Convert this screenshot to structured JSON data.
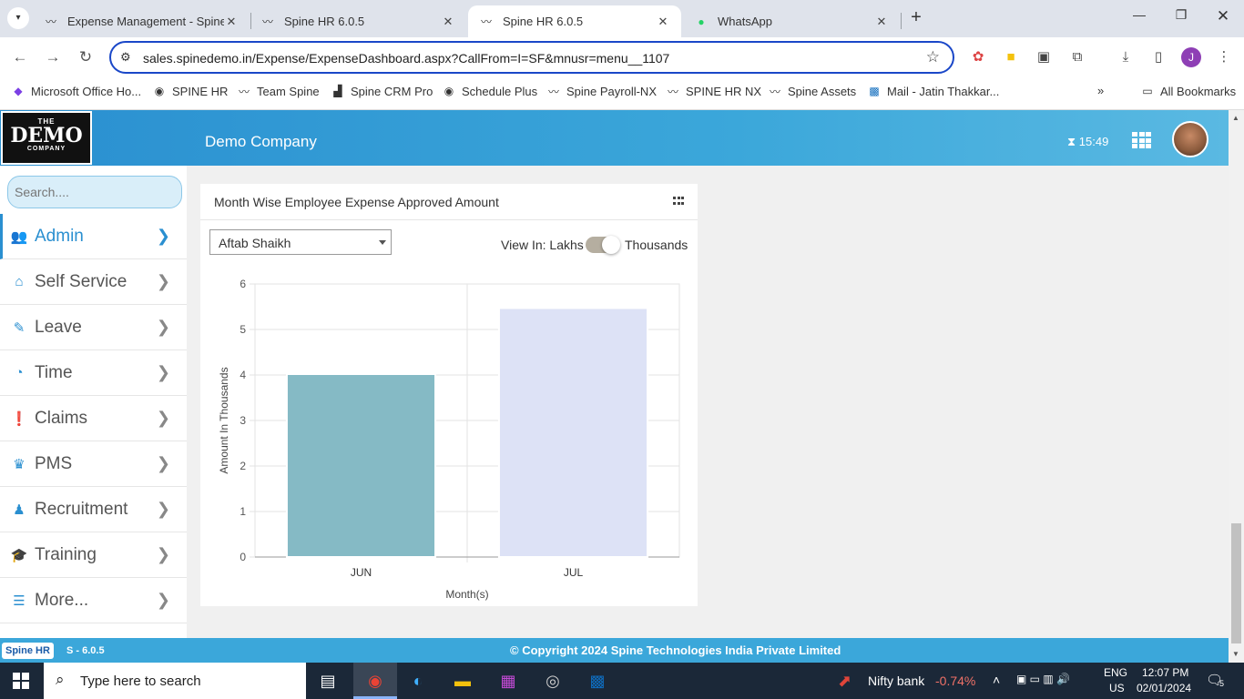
{
  "browser": {
    "tabs": [
      {
        "title": "Expense Management - Spine T",
        "icon": "spine-icon",
        "active": false
      },
      {
        "title": "Spine HR 6.0.5",
        "icon": "spine-icon",
        "active": false
      },
      {
        "title": "Spine HR 6.0.5",
        "icon": "spine-icon",
        "active": true
      },
      {
        "title": "WhatsApp",
        "icon": "whatsapp-icon",
        "active": false
      }
    ],
    "url": "sales.spinedemo.in/Expense/ExpenseDashboard.aspx?CallFrom=I=SF&mnusr=menu__1107",
    "profile_initial": "J",
    "bookmarks": [
      "Microsoft Office Ho...",
      "SPINE HR",
      "Team Spine",
      "Spine CRM Pro",
      "Schedule Plus",
      "Spine Payroll-NX",
      "SPINE HR NX",
      "Spine Assets",
      "Mail - Jatin Thakkar..."
    ],
    "all_bookmarks": "All Bookmarks"
  },
  "header": {
    "logo": {
      "the": "THE",
      "demo": "DEMO",
      "company": "COMPANY"
    },
    "company_name": "Demo Company",
    "time": "15:49"
  },
  "sidebar": {
    "search_placeholder": "Search....",
    "items": [
      {
        "label": "Admin",
        "icon": "admin-icon",
        "active": true
      },
      {
        "label": "Self Service",
        "icon": "home-icon",
        "active": false
      },
      {
        "label": "Leave",
        "icon": "edit-icon",
        "active": false
      },
      {
        "label": "Time",
        "icon": "user-clock-icon",
        "active": false
      },
      {
        "label": "Claims",
        "icon": "alert-icon",
        "active": false
      },
      {
        "label": "PMS",
        "icon": "trophy-icon",
        "active": false
      },
      {
        "label": "Recruitment",
        "icon": "user-tie-icon",
        "active": false
      },
      {
        "label": "Training",
        "icon": "graduation-cap-icon",
        "active": false
      },
      {
        "label": "More...",
        "icon": "list-icon",
        "active": false
      }
    ]
  },
  "panel": {
    "title": "Month Wise Employee Expense Approved Amount",
    "employee_select": "Aftab Shaikh",
    "view_in_label": "View In: Lakhs",
    "view_in_alt": "Thousands"
  },
  "chart_data": {
    "type": "bar",
    "categories": [
      "JUN",
      "JUL"
    ],
    "values": [
      4.02,
      5.47
    ],
    "colors": [
      "#85bac5",
      "#dde2f6"
    ],
    "xlabel": "Month(s)",
    "ylabel": "Amount In Thousands",
    "ylim": [
      0,
      6
    ],
    "yticks": [
      0,
      1,
      2,
      3,
      4,
      5,
      6
    ],
    "grid": true
  },
  "footer": {
    "logo": "Spine HR",
    "version": "S - 6.0.5",
    "copyright": "© Copyright 2024 Spine Technologies India Private Limited"
  },
  "taskbar": {
    "search_placeholder": "Type here to search",
    "stock_name": "Nifty bank",
    "stock_change": "-0.74%",
    "lang_line1": "ENG",
    "lang_line2": "US",
    "time": "12:07 PM",
    "date": "02/01/2024",
    "notification_count": "5"
  }
}
